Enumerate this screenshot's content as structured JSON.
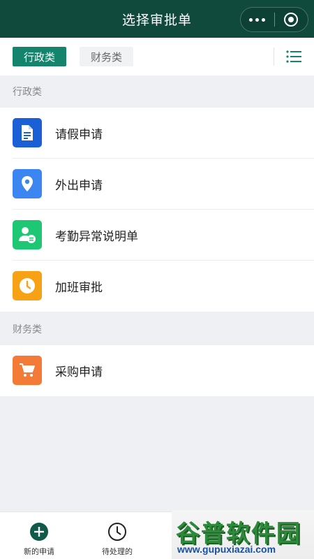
{
  "header": {
    "title": "选择审批单"
  },
  "tabs": [
    {
      "label": "行政类",
      "active": true
    },
    {
      "label": "财务类",
      "active": false
    }
  ],
  "sections": [
    {
      "title": "行政类",
      "items": [
        {
          "label": "请假申请",
          "icon": "document-icon",
          "color": "#1a5fd6"
        },
        {
          "label": "外出申请",
          "icon": "location-pin-icon",
          "color": "#3b86f0"
        },
        {
          "label": "考勤异常说明单",
          "icon": "user-note-icon",
          "color": "#1ec773"
        },
        {
          "label": "加班审批",
          "icon": "clock-icon",
          "color": "#f6a214"
        }
      ]
    },
    {
      "title": "财务类",
      "items": [
        {
          "label": "采购申请",
          "icon": "cart-icon",
          "color": "#f47b37"
        }
      ]
    }
  ],
  "bottom_nav": [
    {
      "label": "新的申请",
      "icon": "plus-circle-icon",
      "active": true
    },
    {
      "label": "待处理的",
      "icon": "clock-outline-icon",
      "active": false
    }
  ],
  "watermark": {
    "main": "谷普软件园",
    "sub": "www.gupuxiazai.com"
  },
  "colors": {
    "header_bg": "#0f4a3d",
    "accent": "#14856c"
  }
}
